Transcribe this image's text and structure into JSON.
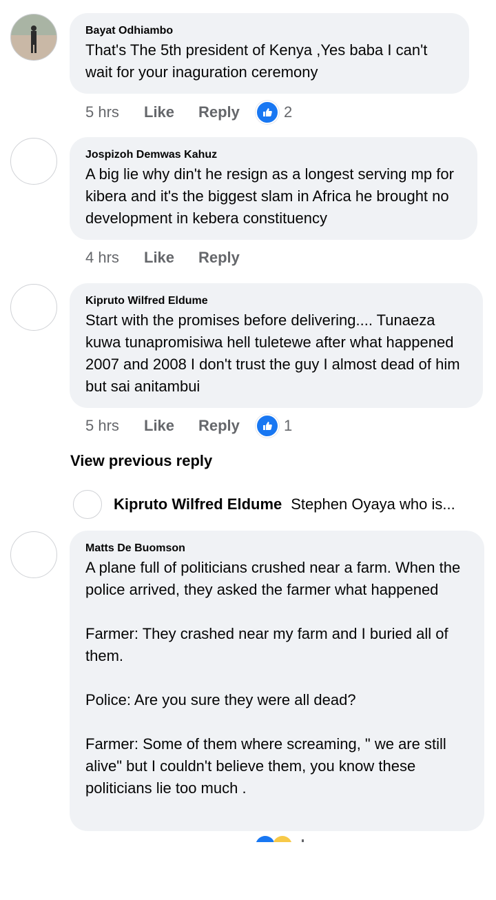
{
  "actions": {
    "like": "Like",
    "reply": "Reply"
  },
  "comments": [
    {
      "author": "Bayat Odhiambo",
      "text": [
        "That's The 5th president of Kenya ,Yes baba I can't wait for your inaguration ceremony"
      ],
      "time": "5 hrs",
      "reactions": "2"
    },
    {
      "author": "Jospizoh Demwas Kahuz",
      "text": [
        "A big lie why din't he resign as a longest serving mp for kibera and it's the biggest slam in Africa he brought no development in kebera constituency"
      ],
      "time": "4 hrs"
    },
    {
      "author": "Kipruto Wilfred Eldume",
      "text": [
        "Start with the promises before delivering.... Tunaeza kuwa tunapromisiwa hell tuletewe after what happened 2007 and 2008 I don't trust the guy I almost dead of him but sai anitambui"
      ],
      "time": "5 hrs",
      "reactions": "1"
    },
    {
      "author": "Matts De Buomson",
      "text": [
        "A plane full of politicians crushed near a farm. When the police arrived, they asked the farmer what happened",
        "Farmer: They crashed near my farm and I buried all of them.",
        "Police: Are you sure they were all dead?",
        "Farmer: Some of them where screaming, \" we are still alive\" but I couldn't believe them, you know these politicians lie too much ."
      ]
    }
  ],
  "view_previous": "View previous reply",
  "reply_preview": {
    "author": "Kipruto Wilfred Eldume",
    "snippet": "Stephen Oyaya who is..."
  },
  "colors": {
    "bubble": "#f0f2f5",
    "meta": "#65676b",
    "like_blue": "#1877f2"
  },
  "icons": {
    "like_reaction": "thumbs-up-icon",
    "haha_reaction": "laughing-face-icon"
  }
}
